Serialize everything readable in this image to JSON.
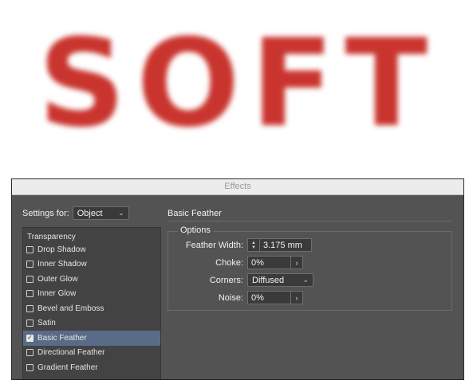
{
  "hero": {
    "text": "SOFT",
    "color": "#c9342e"
  },
  "dialog": {
    "title": "Effects",
    "settings_for_label": "Settings for:",
    "settings_for_value": "Object",
    "list": {
      "header": "Transparency",
      "items": [
        {
          "label": "Drop Shadow",
          "checked": false,
          "selected": false
        },
        {
          "label": "Inner Shadow",
          "checked": false,
          "selected": false
        },
        {
          "label": "Outer Glow",
          "checked": false,
          "selected": false
        },
        {
          "label": "Inner Glow",
          "checked": false,
          "selected": false
        },
        {
          "label": "Bevel and Emboss",
          "checked": false,
          "selected": false
        },
        {
          "label": "Satin",
          "checked": false,
          "selected": false
        },
        {
          "label": "Basic Feather",
          "checked": true,
          "selected": true
        },
        {
          "label": "Directional Feather",
          "checked": false,
          "selected": false
        },
        {
          "label": "Gradient Feather",
          "checked": false,
          "selected": false
        }
      ]
    },
    "section_title": "Basic Feather",
    "options_legend": "Options",
    "options": {
      "feather_width": {
        "label": "Feather Width:",
        "value": "3.175 mm"
      },
      "choke": {
        "label": "Choke:",
        "value": "0%"
      },
      "corners": {
        "label": "Corners:",
        "value": "Diffused"
      },
      "noise": {
        "label": "Noise:",
        "value": "0%"
      }
    },
    "selection_color": "#5a6b87"
  }
}
